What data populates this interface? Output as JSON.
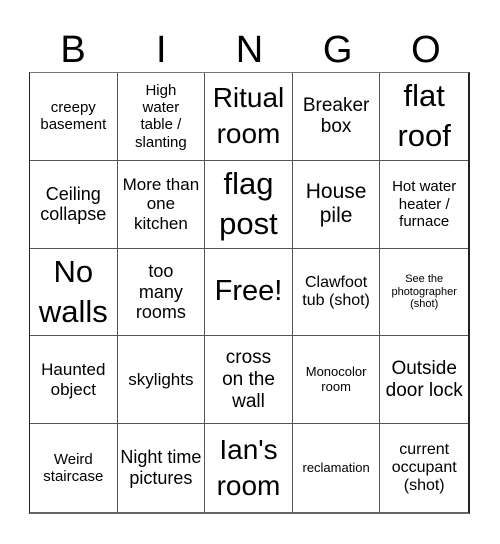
{
  "header": {
    "letters": [
      "B",
      "I",
      "N",
      "G",
      "O"
    ]
  },
  "board": {
    "cells": [
      "creepy basement",
      "High water table / slanting",
      "Ritual room",
      "Breaker box",
      "flat roof",
      "Ceiling collapse",
      "More than one kitchen",
      "flag post",
      "House pile",
      "Hot water heater / furnace",
      "No walls",
      "too many rooms",
      "Free!",
      "Clawfoot tub (shot)",
      "See the photographer (shot)",
      "Haunted object",
      "skylights",
      "cross on the wall",
      "Monocolor room",
      "Outside door lock",
      "Weird staircase",
      "Night time pictures",
      "Ian's room",
      "reclamation",
      "current occupant (shot)"
    ]
  }
}
